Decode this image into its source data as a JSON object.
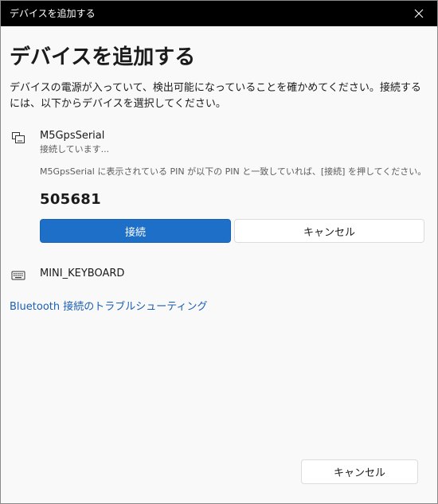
{
  "window": {
    "title": "デバイスを追加する"
  },
  "heading": "デバイスを追加する",
  "description": "デバイスの電源が入っていて、検出可能になっていることを確かめてください。接続するには、以下からデバイスを選択してください。",
  "devices": [
    {
      "name": "M5GpsSerial",
      "icon": "device-pair-icon",
      "status": "接続しています...",
      "instruction": "M5GpsSerial に表示されている PIN が以下の PIN と一致していれば、[接続] を押してください。",
      "pin": "505681",
      "connect_label": "接続",
      "cancel_label": "キャンセル"
    },
    {
      "name": "MINI_KEYBOARD",
      "icon": "keyboard-icon"
    }
  ],
  "troubleshoot_link": "Bluetooth 接続のトラブルシューティング",
  "footer": {
    "cancel_label": "キャンセル"
  },
  "colors": {
    "titlebar": "#000000",
    "accent": "#1e6fc7",
    "link": "#1a5fb4",
    "background": "#f9f9f9"
  }
}
